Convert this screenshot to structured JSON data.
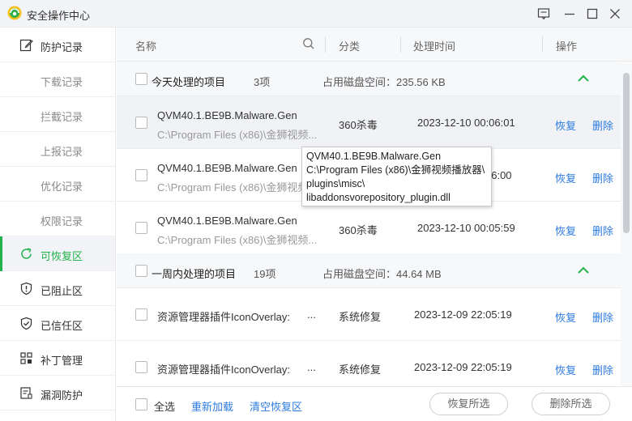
{
  "app": {
    "title": "安全操作中心"
  },
  "colors": {
    "accent": "#23b14d",
    "link": "#2e7be0"
  },
  "icons": {
    "logo": "360-shield-logo",
    "feedback": "feedback-icon",
    "minimize": "minimize-icon",
    "maximize": "maximize-icon",
    "close": "close-icon"
  },
  "sidebar": {
    "items": [
      {
        "label": "防护记录",
        "icon": "edit-record-icon"
      },
      {
        "label": "下载记录"
      },
      {
        "label": "拦截记录"
      },
      {
        "label": "上报记录"
      },
      {
        "label": "优化记录"
      },
      {
        "label": "权限记录"
      },
      {
        "label": "可恢复区",
        "icon": "restore-icon",
        "active": true
      },
      {
        "label": "已阻止区",
        "icon": "blocked-icon"
      },
      {
        "label": "已信任区",
        "icon": "trusted-shield-icon"
      },
      {
        "label": "补丁管理",
        "icon": "patch-icon"
      },
      {
        "label": "漏洞防护",
        "icon": "vulnerability-icon"
      }
    ]
  },
  "table": {
    "headers": {
      "name": "名称",
      "category": "分类",
      "time": "处理时间",
      "action": "操作"
    }
  },
  "groups": [
    {
      "title": "今天处理的项目",
      "count": "3项",
      "disk": "占用磁盘空间：235.56 KB"
    },
    {
      "title": "一周内处理的项目",
      "count": "19项",
      "disk": "占用磁盘空间：44.64 MB"
    }
  ],
  "items": [
    {
      "name": "QVM40.1.BE9B.Malware.Gen",
      "path": "C:\\Program Files (x86)\\金狮视频...",
      "category": "360杀毒",
      "time": "2023-12-10 00:06:01",
      "restore": "恢复",
      "delete": "删除"
    },
    {
      "name": "QVM40.1.BE9B.Malware.Gen",
      "path": "C:\\Program Files (x86)\\金狮视频...",
      "category": "",
      "time": "06:00",
      "restore": "恢复",
      "delete": "删除"
    },
    {
      "name": "QVM40.1.BE9B.Malware.Gen",
      "path": "C:\\Program Files (x86)\\金狮视频...",
      "category": "360杀毒",
      "time": "2023-12-10 00:05:59",
      "restore": "恢复",
      "delete": "删除"
    },
    {
      "name": "资源管理器插件IconOverlay:",
      "dots": "...",
      "category": "系统修复",
      "time": "2023-12-09 22:05:19",
      "restore": "恢复",
      "delete": "删除"
    },
    {
      "name": "资源管理器插件IconOverlay:",
      "dots": "...",
      "category": "系统修复",
      "time": "2023-12-09 22:05:19",
      "restore": "恢复",
      "delete": "删除"
    }
  ],
  "tooltip": {
    "lines": [
      "QVM40.1.BE9B.Malware.Gen",
      "C:\\Program Files (x86)\\金狮视频播放器\\",
      "plugins\\misc\\",
      "libaddonsvorepository_plugin.dll"
    ]
  },
  "footer": {
    "select_all": "全选",
    "reload": "重新加载",
    "clear": "清空恢复区",
    "restore_selected": "恢复所选",
    "delete_selected": "删除所选"
  }
}
